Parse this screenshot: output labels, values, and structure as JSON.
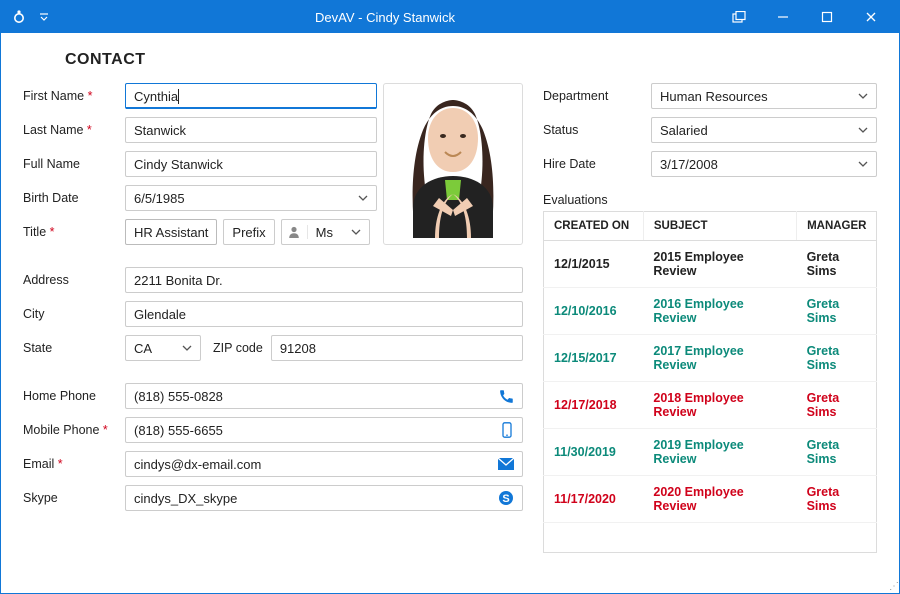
{
  "window": {
    "title": "DevAV - Cindy Stanwick"
  },
  "heading": "CONTACT",
  "labels": {
    "firstName": "First Name",
    "lastName": "Last Name",
    "fullName": "Full Name",
    "birthDate": "Birth Date",
    "title": "Title",
    "prefix": "Prefix",
    "address": "Address",
    "city": "City",
    "state": "State",
    "zip": "ZIP code",
    "homePhone": "Home Phone",
    "mobilePhone": "Mobile Phone",
    "email": "Email",
    "skype": "Skype",
    "department": "Department",
    "status": "Status",
    "hireDate": "Hire Date",
    "evaluations": "Evaluations"
  },
  "values": {
    "firstName": "Cynthia",
    "lastName": "Stanwick",
    "fullName": "Cindy Stanwick",
    "birthDate": "6/5/1985",
    "title": "HR Assistant",
    "prefix": "Ms",
    "address": "2211 Bonita Dr.",
    "city": "Glendale",
    "state": "CA",
    "zip": "91208",
    "homePhone": "(818) 555-0828",
    "mobilePhone": "(818) 555-6655",
    "email": "cindys@dx-email.com",
    "skype": "cindys_DX_skype",
    "department": "Human Resources",
    "status": "Salaried",
    "hireDate": "3/17/2008"
  },
  "evalHeaders": {
    "created": "CREATED ON",
    "subject": "SUBJECT",
    "manager": "MANAGER"
  },
  "evaluations": [
    {
      "date": "12/1/2015",
      "subject": "2015 Employee Review",
      "manager": "Greta Sims",
      "style": "bold"
    },
    {
      "date": "12/10/2016",
      "subject": "2016 Employee Review",
      "manager": "Greta Sims",
      "style": "teal bold"
    },
    {
      "date": "12/15/2017",
      "subject": "2017 Employee Review",
      "manager": "Greta Sims",
      "style": "teal bold"
    },
    {
      "date": "12/17/2018",
      "subject": "2018 Employee Review",
      "manager": "Greta Sims",
      "style": "red bold"
    },
    {
      "date": "11/30/2019",
      "subject": "2019 Employee Review",
      "manager": "Greta Sims",
      "style": "teal bold"
    },
    {
      "date": "11/17/2020",
      "subject": "2020 Employee Review",
      "manager": "Greta Sims",
      "style": "red bold"
    }
  ]
}
